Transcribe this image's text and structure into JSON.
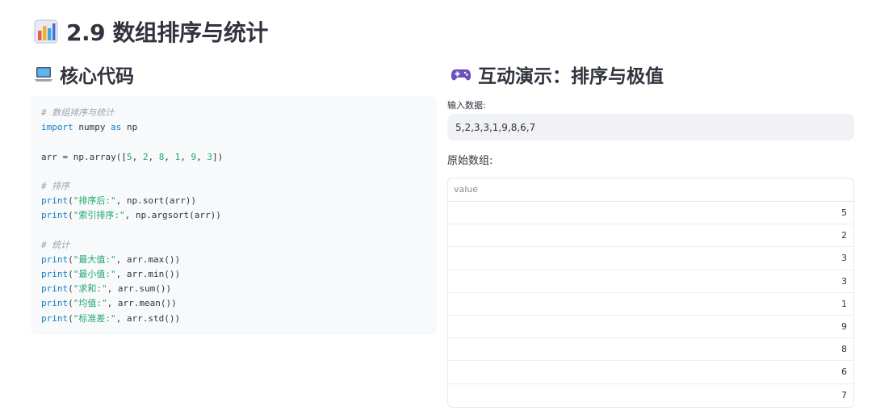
{
  "page": {
    "title": "2.9 数组排序与统计",
    "title_icon": "bar-chart-icon"
  },
  "left": {
    "heading": "核心代码",
    "heading_icon": "laptop-icon",
    "code_lines": [
      "# 数组排序与统计",
      "import numpy as np",
      "",
      "arr = np.array([5, 2, 8, 1, 9, 3])",
      "",
      "# 排序",
      "print(\"排序后:\", np.sort(arr))",
      "print(\"索引排序:\", np.argsort(arr))",
      "",
      "# 统计",
      "print(\"最大值:\", arr.max())",
      "print(\"最小值:\", arr.min())",
      "print(\"求和:\", arr.sum())",
      "print(\"均值:\", arr.mean())",
      "print(\"标准差:\", arr.std())"
    ]
  },
  "right": {
    "heading": "互动演示：排序与极值",
    "heading_icon": "gamepad-icon",
    "input_label": "输入数据:",
    "input_value": "5,2,3,3,1,9,8,6,7",
    "original_label": "原始数组:",
    "table_header": "value",
    "table_values": [
      "5",
      "2",
      "3",
      "3",
      "1",
      "9",
      "8",
      "6",
      "7"
    ]
  },
  "colors": {
    "text": "#31333f",
    "keyword": "#0f7fc5",
    "string": "#1ea96a",
    "comment": "#a0a3ad",
    "code_bg": "#f8f9fb",
    "input_bg": "#f0f2f6"
  }
}
